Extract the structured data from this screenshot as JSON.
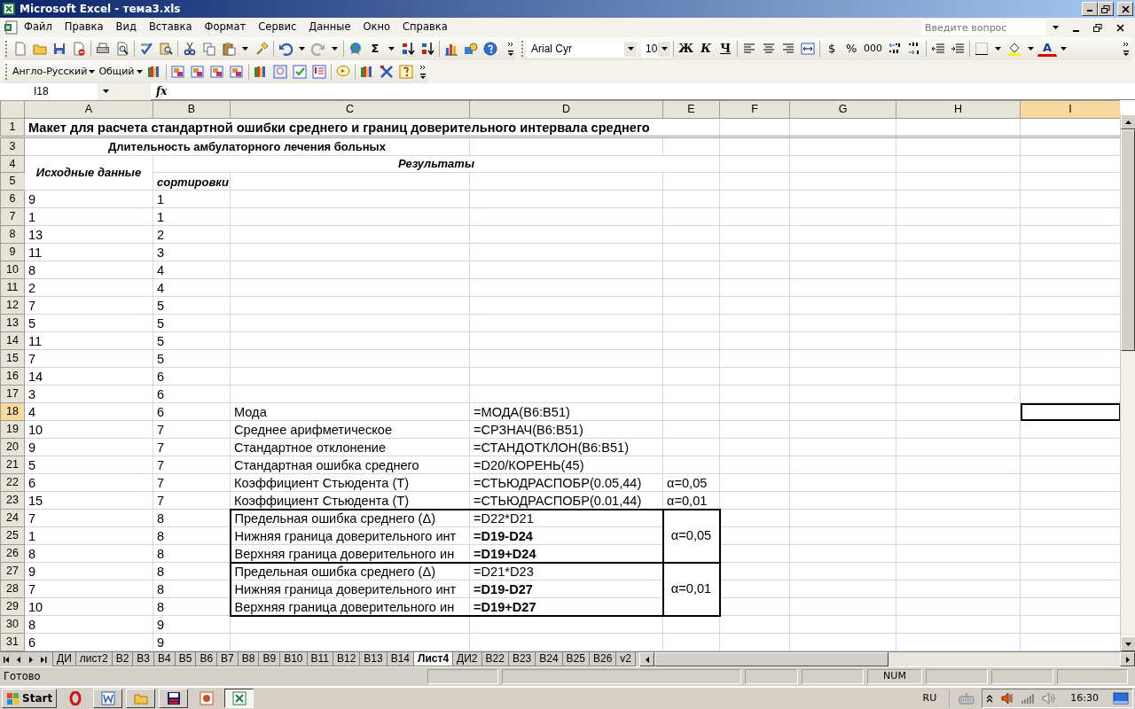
{
  "window": {
    "title": "Microsoft Excel - тема3.xls"
  },
  "menu": [
    "Файл",
    "Правка",
    "Вид",
    "Вставка",
    "Формат",
    "Сервис",
    "Данные",
    "Окно",
    "Справка"
  ],
  "help_search": {
    "placeholder": "Введите вопрос"
  },
  "standard_toolbar": {
    "sum": "Σ"
  },
  "formatting_toolbar": {
    "font": "Arial Cyr",
    "size": "10",
    "bold": "Ж",
    "italic": "К",
    "underline": "Ч",
    "currency": "$",
    "percent": "%",
    "thousands": "000",
    "font_color": "A"
  },
  "dictionary_toolbar": {
    "dictionary": "Англо-Русский",
    "topic": "Общий"
  },
  "formula_bar": {
    "name_box": "I18",
    "fx": "fx"
  },
  "columns": [
    {
      "label": "A",
      "selected": false
    },
    {
      "label": "B",
      "selected": false
    },
    {
      "label": "C",
      "selected": false
    },
    {
      "label": "D",
      "selected": false
    },
    {
      "label": "E",
      "selected": false
    },
    {
      "label": "F",
      "selected": false
    },
    {
      "label": "G",
      "selected": false
    },
    {
      "label": "H",
      "selected": false
    },
    {
      "label": "I",
      "selected": true
    }
  ],
  "rows": [
    {
      "label": "1",
      "selected": false,
      "cells": {
        "A": {
          "text": "Макет для расчета стандартной ошибки среднего и границ доверительного интервала среднего",
          "bold": true
        }
      }
    },
    {
      "label": "3",
      "selected": false,
      "cells": {
        "A": {
          "text": "Длительность амбулаторного лечения больных",
          "bold": true
        }
      }
    },
    {
      "label": "4",
      "selected": false,
      "cells": {
        "A": {
          "text": "Исходные данные",
          "bold": true,
          "italic": true
        },
        "B": {
          "text": "Результаты",
          "bold": true,
          "italic": true
        }
      }
    },
    {
      "label": "5",
      "selected": false,
      "cells": {
        "B": {
          "text": "сортировки",
          "bold": true,
          "italic": true
        }
      }
    },
    {
      "label": "6",
      "selected": false,
      "cells": {
        "A": {
          "text": "9"
        },
        "B": {
          "text": "1"
        }
      }
    },
    {
      "label": "7",
      "selected": false,
      "cells": {
        "A": {
          "text": "1"
        },
        "B": {
          "text": "1"
        }
      }
    },
    {
      "label": "8",
      "selected": false,
      "cells": {
        "A": {
          "text": "13"
        },
        "B": {
          "text": "2"
        }
      }
    },
    {
      "label": "9",
      "selected": false,
      "cells": {
        "A": {
          "text": "11"
        },
        "B": {
          "text": "3"
        }
      }
    },
    {
      "label": "10",
      "selected": false,
      "cells": {
        "A": {
          "text": "8"
        },
        "B": {
          "text": "4"
        }
      }
    },
    {
      "label": "11",
      "selected": false,
      "cells": {
        "A": {
          "text": "2"
        },
        "B": {
          "text": "4"
        }
      }
    },
    {
      "label": "12",
      "selected": false,
      "cells": {
        "A": {
          "text": "7"
        },
        "B": {
          "text": "5"
        }
      }
    },
    {
      "label": "13",
      "selected": false,
      "cells": {
        "A": {
          "text": "5"
        },
        "B": {
          "text": "5"
        }
      }
    },
    {
      "label": "14",
      "selected": false,
      "cells": {
        "A": {
          "text": "11"
        },
        "B": {
          "text": "5"
        }
      }
    },
    {
      "label": "15",
      "selected": false,
      "cells": {
        "A": {
          "text": "7"
        },
        "B": {
          "text": "5"
        }
      }
    },
    {
      "label": "16",
      "selected": false,
      "cells": {
        "A": {
          "text": "14"
        },
        "B": {
          "text": "6"
        }
      }
    },
    {
      "label": "17",
      "selected": false,
      "cells": {
        "A": {
          "text": "3"
        },
        "B": {
          "text": "6"
        }
      }
    },
    {
      "label": "18",
      "selected": true,
      "cells": {
        "A": {
          "text": "4"
        },
        "B": {
          "text": "6"
        },
        "C": {
          "text": "Мода"
        },
        "D": {
          "text": "=МОДА(B6:B51)"
        }
      }
    },
    {
      "label": "19",
      "selected": false,
      "cells": {
        "A": {
          "text": "10"
        },
        "B": {
          "text": "7"
        },
        "C": {
          "text": "Среднее арифметическое"
        },
        "D": {
          "text": "=СРЗНАЧ(B6:B51)"
        }
      }
    },
    {
      "label": "20",
      "selected": false,
      "cells": {
        "A": {
          "text": "9"
        },
        "B": {
          "text": "7"
        },
        "C": {
          "text": "Стандартное отклонение"
        },
        "D": {
          "text": "=СТАНДОТКЛОН(B6:B51)"
        }
      }
    },
    {
      "label": "21",
      "selected": false,
      "cells": {
        "A": {
          "text": "5"
        },
        "B": {
          "text": "7"
        },
        "C": {
          "text": "Стандартная ошибка среднего"
        },
        "D": {
          "text": "=D20/КОРЕНЬ(45)"
        }
      }
    },
    {
      "label": "22",
      "selected": false,
      "cells": {
        "A": {
          "text": "6"
        },
        "B": {
          "text": "7"
        },
        "C": {
          "text": "Коэффициент Стьюдента (Т)"
        },
        "D": {
          "text": "=СТЬЮДРАСПОБР(0.05,44)"
        },
        "E": {
          "text": "α=0,05"
        }
      }
    },
    {
      "label": "23",
      "selected": false,
      "cells": {
        "A": {
          "text": "15"
        },
        "B": {
          "text": "7"
        },
        "C": {
          "text": "Коэффициент Стьюдента (Т)"
        },
        "D": {
          "text": "=СТЬЮДРАСПОБР(0.01,44)"
        },
        "E": {
          "text": "α=0,01"
        }
      }
    },
    {
      "label": "24",
      "selected": false,
      "boxed": true,
      "box_start": true,
      "cells": {
        "A": {
          "text": "7"
        },
        "B": {
          "text": "8"
        },
        "C": {
          "text": "Предельная ошибка среднего (Δ)"
        },
        "D": {
          "text": "=D22*D21"
        },
        "E": {
          "text": "α=0,05"
        }
      }
    },
    {
      "label": "25",
      "selected": false,
      "boxed": true,
      "cells": {
        "A": {
          "text": "1"
        },
        "B": {
          "text": "8"
        },
        "C": {
          "text": "Нижняя граница доверительного инт"
        },
        "D": {
          "text": "=D19-D24",
          "bold": true
        }
      }
    },
    {
      "label": "26",
      "selected": false,
      "boxed": true,
      "cells": {
        "A": {
          "text": "8"
        },
        "B": {
          "text": "8"
        },
        "C": {
          "text": "Верхняя граница доверительного ин"
        },
        "D": {
          "text": "=D19+D24",
          "bold": true
        }
      }
    },
    {
      "label": "27",
      "selected": false,
      "boxed": true,
      "box_start": true,
      "cells": {
        "A": {
          "text": "9"
        },
        "B": {
          "text": "8"
        },
        "C": {
          "text": "Предельная ошибка среднего (Δ)"
        },
        "D": {
          "text": "=D21*D23"
        },
        "E": {
          "text": "α=0,01"
        }
      }
    },
    {
      "label": "28",
      "selected": false,
      "boxed": true,
      "cells": {
        "A": {
          "text": "7"
        },
        "B": {
          "text": "8"
        },
        "C": {
          "text": "Нижняя граница доверительного инт"
        },
        "D": {
          "text": "=D19-D27",
          "bold": true
        }
      }
    },
    {
      "label": "29",
      "selected": false,
      "boxed": true,
      "cells": {
        "A": {
          "text": "10"
        },
        "B": {
          "text": "8"
        },
        "C": {
          "text": "Верхняя граница доверительного ин"
        },
        "D": {
          "text": "=D19+D27",
          "bold": true
        }
      }
    },
    {
      "label": "30",
      "selected": false,
      "cells": {
        "A": {
          "text": "8"
        },
        "B": {
          "text": "9"
        }
      }
    },
    {
      "label": "31",
      "selected": false,
      "cells": {
        "A": {
          "text": "6"
        },
        "B": {
          "text": "9"
        }
      }
    }
  ],
  "sheet_tabs": [
    {
      "label": "ДИ",
      "selected": false
    },
    {
      "label": "лист2",
      "selected": false
    },
    {
      "label": "B2",
      "selected": false
    },
    {
      "label": "B3",
      "selected": false
    },
    {
      "label": "B4",
      "selected": false
    },
    {
      "label": "B5",
      "selected": false
    },
    {
      "label": "B6",
      "selected": false
    },
    {
      "label": "B7",
      "selected": false
    },
    {
      "label": "B8",
      "selected": false
    },
    {
      "label": "B9",
      "selected": false
    },
    {
      "label": "B10",
      "selected": false
    },
    {
      "label": "B11",
      "selected": false
    },
    {
      "label": "B12",
      "selected": false
    },
    {
      "label": "B13",
      "selected": false
    },
    {
      "label": "B14",
      "selected": false
    },
    {
      "label": "Лист4",
      "selected": true
    },
    {
      "label": "ДИ2",
      "selected": false
    },
    {
      "label": "B22",
      "selected": false
    },
    {
      "label": "B23",
      "selected": false
    },
    {
      "label": "B24",
      "selected": false
    },
    {
      "label": "B25",
      "selected": false
    },
    {
      "label": "B26",
      "selected": false
    },
    {
      "label": "v2",
      "selected": false
    }
  ],
  "status_bar": {
    "text": "Готово",
    "indicators": [
      "NUM"
    ]
  },
  "taskbar": {
    "start": "Start",
    "apps": [
      {
        "kind": "opera",
        "active": false
      },
      {
        "kind": "word",
        "active": false
      },
      {
        "kind": "folder",
        "active": false
      },
      {
        "kind": "floppy",
        "active": false
      },
      {
        "kind": "powerpoint",
        "active": false
      },
      {
        "kind": "excel",
        "active": true
      }
    ],
    "language": "RU",
    "clock": "16:30"
  }
}
